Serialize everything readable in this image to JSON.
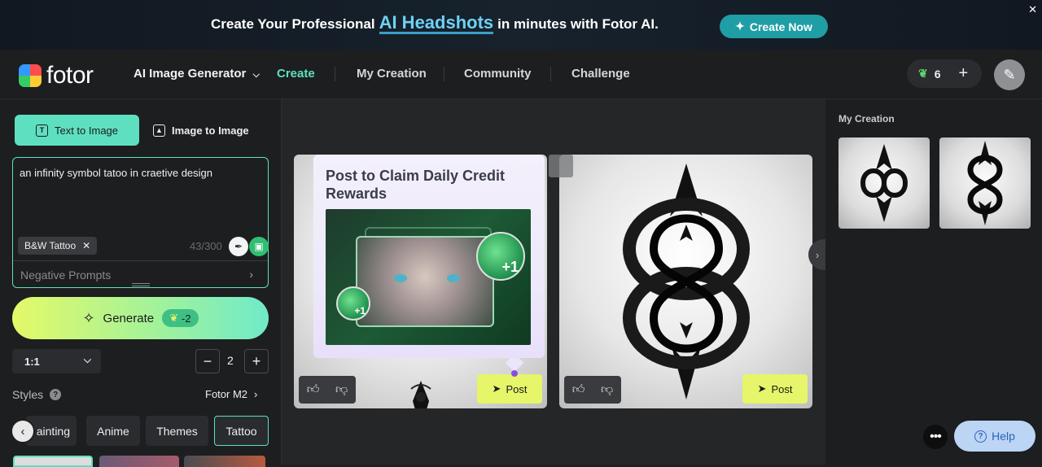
{
  "banner": {
    "text_before": "Create Your Professional",
    "highlight": "AI Headshots",
    "text_after": "in minutes with Fotor AI.",
    "cta_label": "Create Now",
    "cta_icon": "magic-wand-icon",
    "close_icon": "close-icon"
  },
  "nav": {
    "logo_text": "fotor",
    "product_dropdown": "AI Image Generator",
    "items": [
      "Create",
      "My Creation",
      "Community",
      "Challenge"
    ],
    "active_item": "Create",
    "credits": "6",
    "credit_icon": "leaf-icon",
    "add_credits_icon": "plus-icon",
    "avatar_icon": "user-avatar-icon"
  },
  "left": {
    "tab_text_to_image": "Text to Image",
    "tab_image_to_image": "Image to Image",
    "prompt_text": "an infinity symbol tatoo in craetive design",
    "style_chip": "B&W Tattoo",
    "char_count": "43/300",
    "negative_prompts": "Negative Prompts",
    "generate_label": "Generate",
    "generate_cost": "-2",
    "ratio": "1:1",
    "count_value": "2",
    "styles_label": "Styles",
    "model_label": "Fotor M2",
    "style_tabs": [
      "Painting",
      "Anime",
      "Themes",
      "Tattoo"
    ],
    "active_style_tab": "Tattoo"
  },
  "center": {
    "tooltip_title": "Post to Claim Daily Credit Rewards",
    "tooltip_badge_large": "+1",
    "tooltip_badge_small": "+1",
    "post_label": "Post",
    "like_icon": "thumbs-up-icon",
    "dislike_icon": "thumbs-down-icon",
    "post_icon": "send-icon"
  },
  "right": {
    "title": "My Creation"
  },
  "help": {
    "label": "Help",
    "more_icon": "more-dots-icon"
  },
  "colors": {
    "accent": "#5ee0c0",
    "post_button": "#e6f569",
    "banner_cta": "#1f9ea5"
  }
}
